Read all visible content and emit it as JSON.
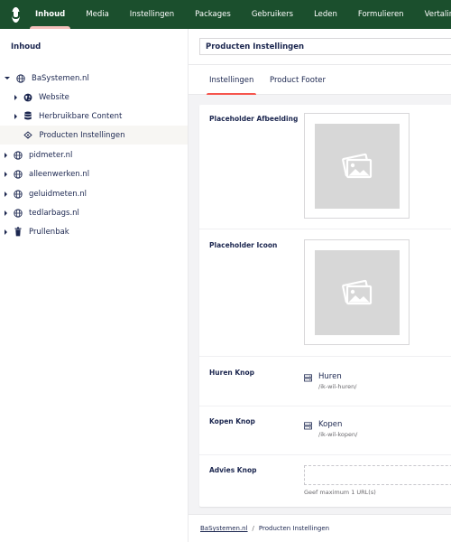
{
  "nav": {
    "items": [
      "Inhoud",
      "Media",
      "Instellingen",
      "Packages",
      "Gebruikers",
      "Leden",
      "Formulieren",
      "Vertaling"
    ]
  },
  "sidebar": {
    "title": "Inhoud",
    "tree": [
      {
        "label": "BaSystemen.nl",
        "icon": "globe-icon",
        "expanded": true
      },
      {
        "label": "Website",
        "icon": "globe-filled-icon"
      },
      {
        "label": "Herbruikbare Content",
        "icon": "database-icon"
      },
      {
        "label": "Producten Instellingen",
        "icon": "settings-icon",
        "selected": true
      },
      {
        "label": "pidmeter.nl",
        "icon": "globe-icon"
      },
      {
        "label": "alleenwerken.nl",
        "icon": "globe-icon"
      },
      {
        "label": "geluidmeten.nl",
        "icon": "globe-icon"
      },
      {
        "label": "tedlarbags.nl",
        "icon": "globe-icon"
      },
      {
        "label": "Prullenbak",
        "icon": "trash-icon"
      }
    ]
  },
  "editor": {
    "name_value": "Producten Instellingen",
    "tabs": [
      "Instellingen",
      "Product Footer"
    ],
    "active_tab": "Instellingen",
    "properties": {
      "placeholder_afbeelding": "Placeholder Afbeelding",
      "placeholder_icoon": "Placeholder Icoon",
      "huren_knop": "Huren Knop",
      "kopen_knop": "Kopen Knop",
      "advies_knop": "Advies Knop"
    },
    "links": {
      "huren": {
        "name": "Huren",
        "url": "/ik-wil-huren/"
      },
      "kopen": {
        "name": "Kopen",
        "url": "/ik-wil-kopen/"
      }
    },
    "advies_helper": "Geef maximum 1 URL(s)"
  },
  "breadcrumb": {
    "items": [
      "BaSystemen.nl",
      "Producten Instellingen"
    ]
  },
  "colors": {
    "topbar": "#1b4f2d",
    "accent": "#f5554d",
    "text": "#1b264f"
  }
}
